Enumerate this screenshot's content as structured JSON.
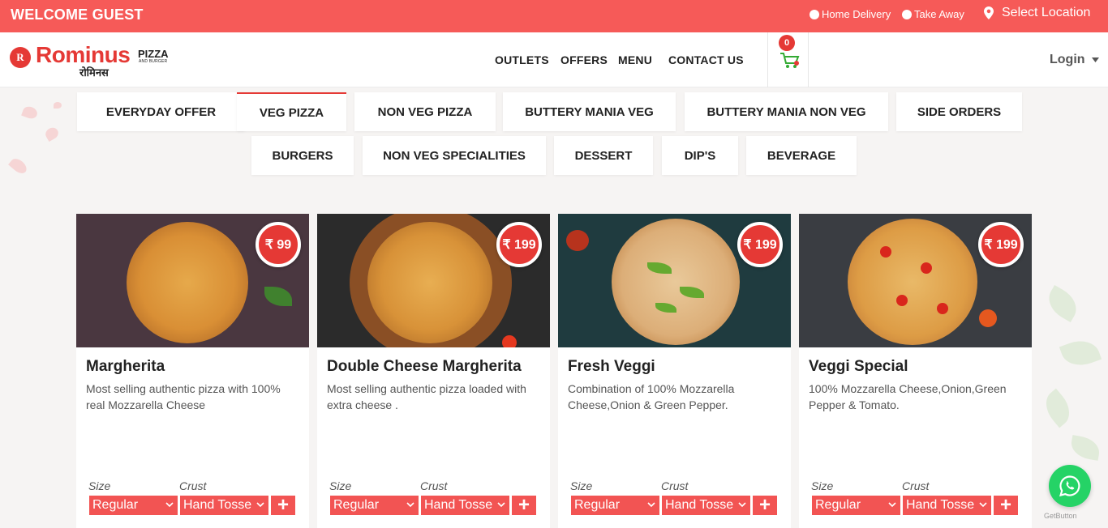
{
  "topbar": {
    "welcome": "WELCOME GUEST",
    "delivery_options": [
      "Home Delivery",
      "Take Away"
    ],
    "location": "Select Location",
    "color": "#f65a58"
  },
  "brand": {
    "name": "Rominus",
    "pizza": "PIZZA",
    "sub": "AND BURGER",
    "hindi": "रोमिनस",
    "mark": "R",
    "color": "#e53935"
  },
  "nav": {
    "items": [
      "OUTLETS",
      "OFFERS",
      "MENU",
      "CONTACT US"
    ],
    "cart_count": "0",
    "login": "Login",
    "cart_icon": "shopping-cart-icon"
  },
  "categories": [
    "EVERYDAY OFFER",
    "VEG PIZZA",
    "NON VEG PIZZA",
    "BUTTERY MANIA VEG",
    "BUTTERY MANIA NON VEG",
    "SIDE ORDERS",
    "BURGERS",
    "NON VEG SPECIALITIES",
    "DESSERT",
    "DIP'S",
    "BEVERAGE"
  ],
  "active_category": "VEG PIZZA",
  "products": [
    {
      "title": "Margherita",
      "price": "₹ 99",
      "description": "Most selling authentic pizza with 100% real Mozzarella Cheese",
      "size_label": "Size",
      "crust_label": "Crust",
      "size": "Regular",
      "crust": "Hand Tosse"
    },
    {
      "title": "Double Cheese Margherita",
      "price": "₹ 199",
      "description": "Most selling authentic pizza loaded with extra cheese .",
      "size_label": "Size",
      "crust_label": "Crust",
      "size": "Regular",
      "crust": "Hand Tosse"
    },
    {
      "title": "Fresh Veggi",
      "price": "₹ 199",
      "description": "Combination of 100% Mozzarella Cheese,Onion & Green Pepper.",
      "size_label": "Size",
      "crust_label": "Crust",
      "size": "Regular",
      "crust": "Hand Tosse"
    },
    {
      "title": "Veggi Special",
      "price": "₹ 199",
      "description": "100% Mozzarella Cheese,Onion,Green Pepper & Tomato.",
      "size_label": "Size",
      "crust_label": "Crust",
      "size": "Regular",
      "crust": "Hand Tosse"
    }
  ],
  "add_symbol": "+",
  "whatsapp": {
    "icon": "whatsapp-icon",
    "label": "GetButton"
  }
}
